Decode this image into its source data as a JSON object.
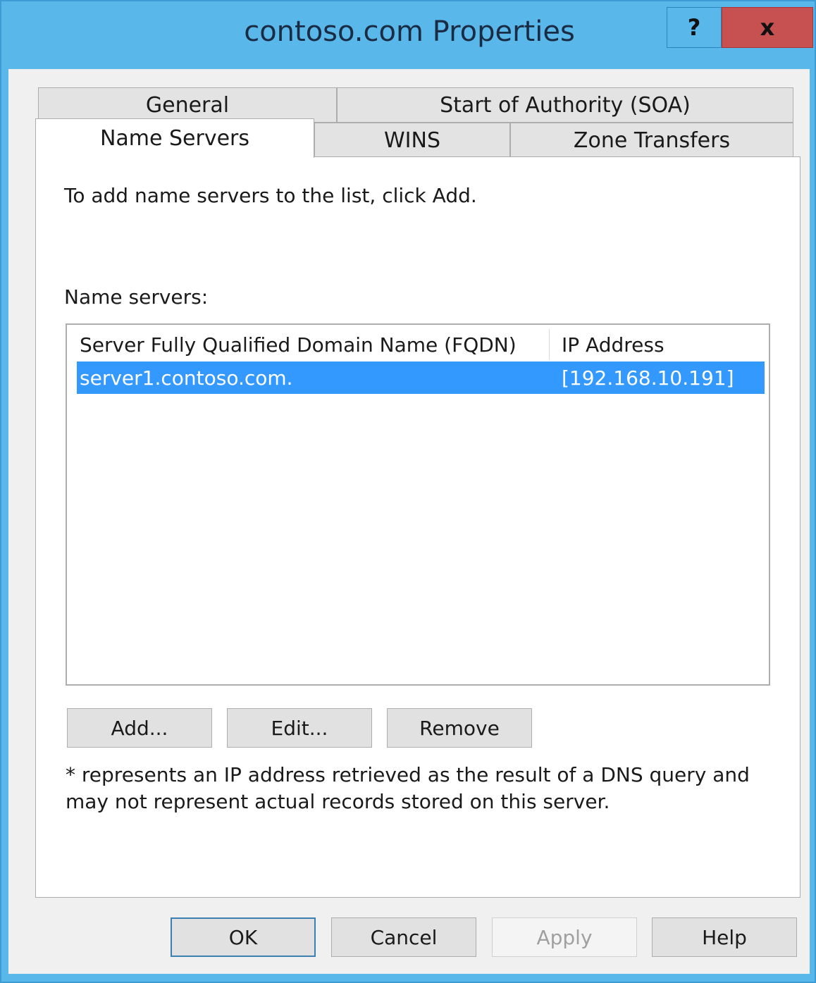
{
  "window": {
    "title": "contoso.com Properties",
    "help_glyph": "?",
    "close_glyph": "x"
  },
  "tabs": {
    "general": "General",
    "soa": "Start of Authority (SOA)",
    "name_servers": "Name Servers",
    "wins": "WINS",
    "zone_transfers": "Zone Transfers"
  },
  "panel": {
    "instruction": "To add name servers to the list, click Add.",
    "list_label": "Name servers:",
    "columns": [
      "Server Fully Qualified Domain Name (FQDN)",
      "IP Address"
    ],
    "rows": [
      {
        "fqdn": "server1.contoso.com.",
        "ip": "[192.168.10.191]",
        "selected": true
      }
    ],
    "buttons": {
      "add": "Add...",
      "edit": "Edit...",
      "remove": "Remove"
    },
    "note": "* represents an IP address retrieved as the result of a DNS query and may not represent actual records stored on this server."
  },
  "footer": {
    "ok": "OK",
    "cancel": "Cancel",
    "apply": "Apply",
    "help": "Help"
  },
  "colors": {
    "title_bar": "#5ab7ea",
    "close_button": "#c75050",
    "selection": "#3399ff"
  }
}
